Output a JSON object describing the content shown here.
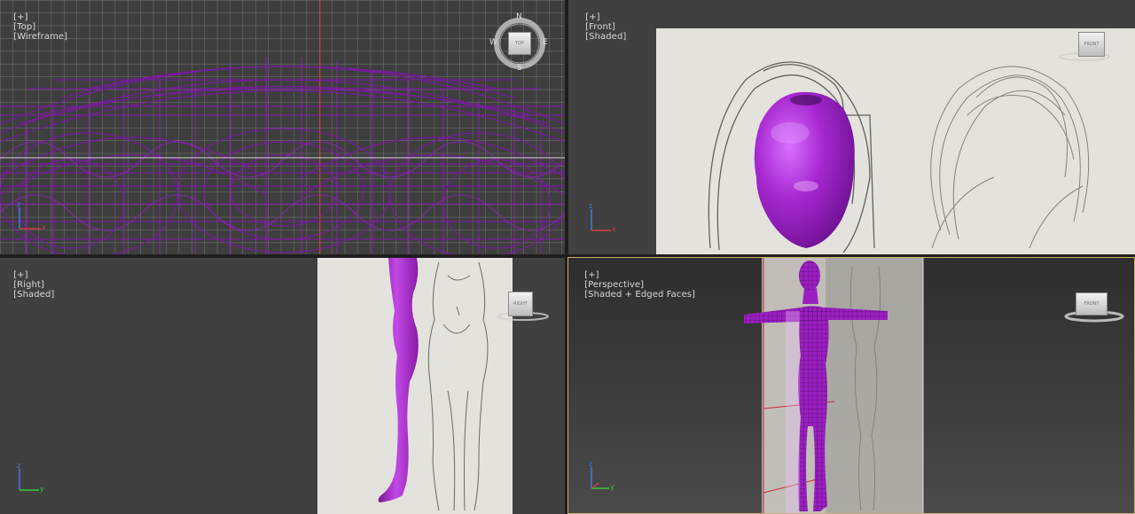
{
  "viewports": {
    "top": {
      "plus": "[+]",
      "view": "[Top]",
      "mode": "[Wireframe]",
      "viewcube": {
        "face": "TOP",
        "n": "N",
        "s": "S",
        "e": "E",
        "w": "W"
      },
      "axes": {
        "v": "z",
        "h": "x"
      }
    },
    "front": {
      "plus": "[+]",
      "view": "[Front]",
      "mode": "[Shaded]",
      "viewcube": {
        "face": "FRONT"
      },
      "axes": {
        "v": "z",
        "h": "x"
      }
    },
    "right": {
      "plus": "[+]",
      "view": "[Right]",
      "mode": "[Shaded]",
      "viewcube": {
        "face": "RIGHT"
      },
      "axes": {
        "v": "z",
        "h": "y"
      }
    },
    "perspective": {
      "plus": "[+]",
      "view": "[Perspective]",
      "mode": "[Shaded + Edged Faces]",
      "viewcube": {
        "face": "FRONT"
      },
      "axes": {
        "v": "z",
        "h": "y"
      },
      "active": true
    }
  },
  "colors": {
    "model": "#9a1fc0",
    "wire": "#7a1aa0",
    "active_border": "#c9b26a",
    "viewport_bg": "#404040",
    "axis_x": "#d23c3c",
    "axis_y": "#3cc83c",
    "axis_z": "#3c7ae6"
  }
}
